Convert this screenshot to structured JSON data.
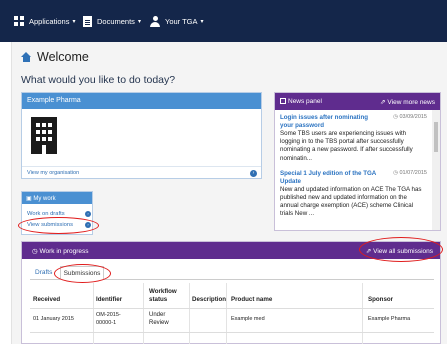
{
  "nav": {
    "items": [
      {
        "label": "Applications",
        "icon": "grid-icon"
      },
      {
        "label": "Documents",
        "icon": "document-icon"
      },
      {
        "label": "Your TGA",
        "icon": "user-icon"
      }
    ],
    "caret": "▾"
  },
  "header": {
    "title": "Welcome",
    "subtitle": "What would you like to do today?"
  },
  "org": {
    "name": "Example Pharma",
    "view_link": "View my organisation"
  },
  "news": {
    "title": "News panel",
    "more": "View more news",
    "items": [
      {
        "title": "Login issues after nominating your password",
        "date": "03/09/2015",
        "body": "Some TBS users are experiencing issues with logging in to the TBS portal after successfully nominating a new password. If after successfully nominatin..."
      },
      {
        "title": "Special 1 July edition of the TGA Update",
        "date": "01/07/2015",
        "body": "New and updated information on ACE The TGA has published new and updated information on the annual charge exemption (ACE) scheme Clinical trials New ..."
      }
    ]
  },
  "mywork": {
    "title": "My work",
    "drafts": "Work on drafts",
    "submissions": "View submissions"
  },
  "wip": {
    "title": "Work in progress",
    "view_all": "View all submissions",
    "tabs": {
      "drafts": "Drafts",
      "submissions": "Submissions"
    },
    "columns": {
      "received": "Received",
      "identifier": "Identifier",
      "workflow1": "Workflow",
      "workflow2": "status",
      "description": "Description",
      "product": "Product name",
      "sponsor": "Sponsor"
    },
    "row": {
      "received": "01 January 2015",
      "id1": "OM-2015-",
      "id2": "00000-1",
      "status1": "Under",
      "status2": "Review",
      "description": "",
      "product": "Example med",
      "sponsor": "Example Pharma"
    }
  },
  "colors": {
    "nav": "#14264a",
    "blue": "#4a90d2",
    "purple": "#5f2c8e",
    "annotation": "#e01c1c"
  }
}
